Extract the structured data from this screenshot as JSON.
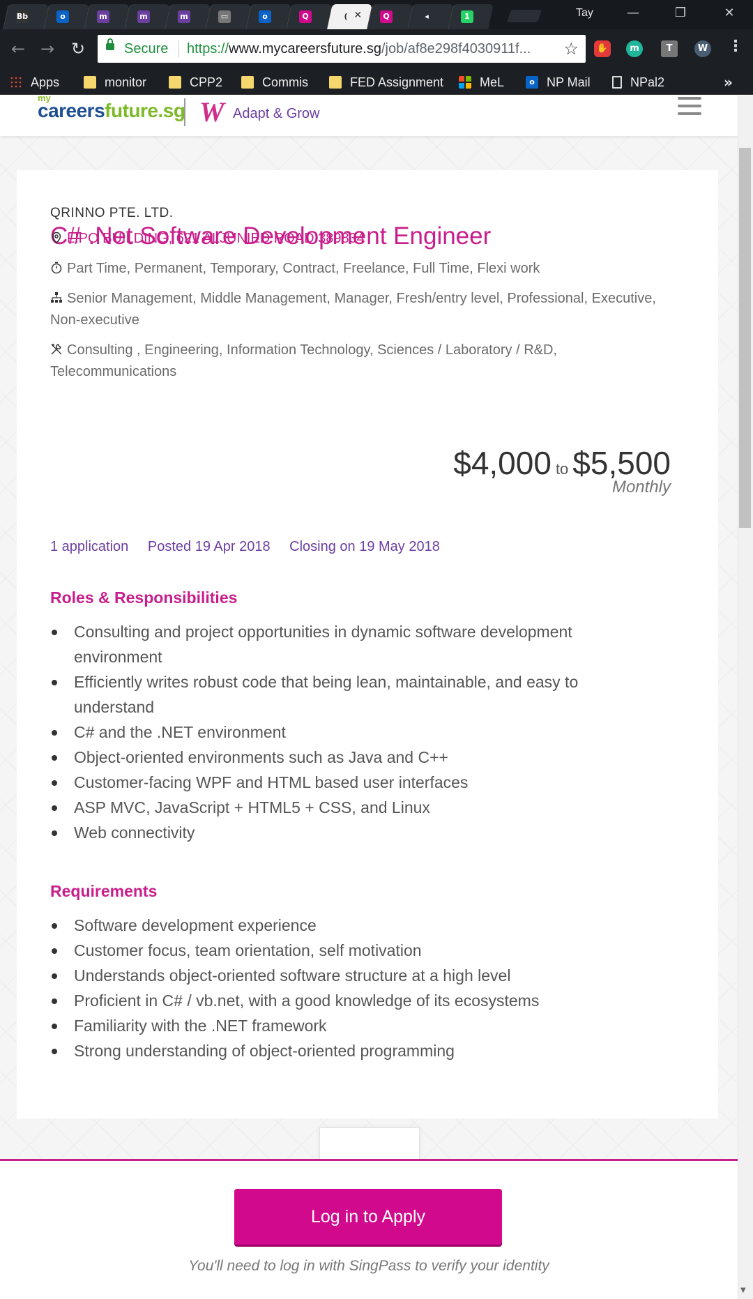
{
  "browser": {
    "user_name": "Tay",
    "tabs": [
      {
        "icon": "blackboard-icon",
        "glyph": "Bb",
        "color": "#333333"
      },
      {
        "icon": "outlook-icon",
        "glyph": "o",
        "color": "#0a64c7"
      },
      {
        "icon": "moodle-icon",
        "glyph": "m",
        "color": "#6b3fa0"
      },
      {
        "icon": "moodle-icon",
        "glyph": "m",
        "color": "#6b3fa0"
      },
      {
        "icon": "moodle-icon",
        "glyph": "m",
        "color": "#6b3fa0"
      },
      {
        "icon": "file-icon",
        "glyph": "▭",
        "color": "#777777"
      },
      {
        "icon": "outlook-icon",
        "glyph": "o",
        "color": "#0a64c7"
      },
      {
        "icon": "search-icon",
        "glyph": "Q",
        "color": "#d10a8d"
      },
      {
        "icon": "loading-icon",
        "glyph": "(",
        "color": "#f1f1f1"
      },
      {
        "icon": "search-icon",
        "glyph": "Q",
        "color": "#d10a8d"
      },
      {
        "icon": "audio-icon",
        "glyph": "◂",
        "color": "#2a2f36"
      },
      {
        "icon": "whatsapp-icon",
        "glyph": "1",
        "color": "#25d366"
      }
    ],
    "secure_label": "Secure",
    "url_scheme": "https://",
    "url_host": "www.mycareersfuture.sg",
    "url_path": "/job/af8e298f4030911f...",
    "bookmarks": {
      "apps": "Apps",
      "b1": "monitor",
      "b2": "CPP2",
      "b3": "Commis",
      "b4": "FED Assignment",
      "b5": "MeL",
      "b6": "NP Mail",
      "b7": "NPal2"
    },
    "accent_color": "#c81e8c"
  },
  "site": {
    "logo_my": "my",
    "logo_careers": "careers",
    "logo_future": "future.sg",
    "adapt_text": "Adapt & Grow"
  },
  "job": {
    "company": "QRINNO PTE. LTD.",
    "title": "C# .Net Software Development Engineer",
    "location": "LIPO BUILDING, 621 ALJUNIED ROAD 389834",
    "employment_type": "Part Time, Permanent, Temporary, Contract, Freelance, Full Time, Flexi work",
    "seniority": "Senior Management, Middle Management, Manager, Fresh/entry level, Professional, Executive, Non-executive",
    "category": "Consulting , Engineering, Information Technology, Sciences / Laboratory / R&D, Telecommunications",
    "salary_min": "$4,000",
    "salary_to": "to",
    "salary_max": "$5,500",
    "salary_period": "Monthly",
    "applications": "1 application",
    "posted": "Posted 19 Apr 2018",
    "closing": "Closing on 19 May 2018",
    "roles_heading": "Roles & Responsibilities",
    "roles": [
      "Consulting and project opportunities in dynamic software development environment",
      "Efficiently writes robust code that being lean, maintainable, and easy to understand",
      "C# and the .NET environment",
      "Object-oriented environments such as Java and C++",
      "Customer-facing WPF and HTML based user interfaces",
      "ASP MVC, JavaScript + HTML5 + CSS, and Linux",
      "Web connectivity"
    ],
    "requirements_heading": "Requirements",
    "requirements": [
      "Software development experience",
      "Customer focus, team orientation, self motivation",
      "Understands object-oriented software structure at a high level",
      "Proficient in C# / vb.net, with a good knowledge of its ecosystems",
      "Familiarity with the .NET framework",
      "Strong understanding of object-oriented programming"
    ]
  },
  "apply": {
    "button_label": "Log in to Apply",
    "note": "You'll need to log in with SingPass to verify your identity"
  }
}
